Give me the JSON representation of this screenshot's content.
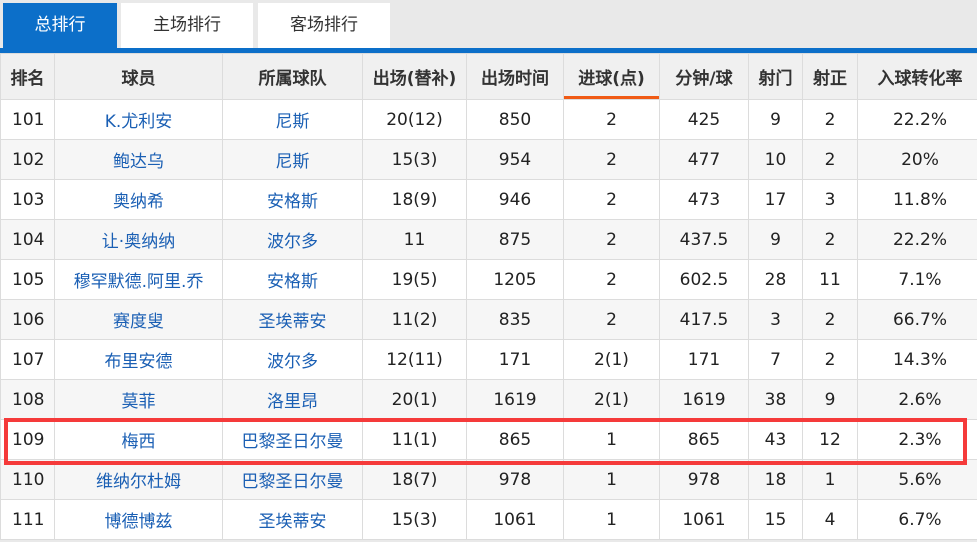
{
  "tabs": [
    {
      "label": "总排行",
      "active": true
    },
    {
      "label": "主场排行",
      "active": false
    },
    {
      "label": "客场排行",
      "active": false
    }
  ],
  "colors": {
    "accent": "#0c6fc9",
    "sort_indicator": "#f05a14",
    "highlight": "#f53a3a",
    "link": "#1a5fb4"
  },
  "table": {
    "headers": [
      "排名",
      "球员",
      "所属球队",
      "出场(替补)",
      "出场时间",
      "进球(点)",
      "分钟/球",
      "射门",
      "射正",
      "入球转化率"
    ],
    "sorted_column": "进球(点)",
    "highlighted_rank": "109",
    "rows": [
      [
        "101",
        "K.尤利安",
        "尼斯",
        "20(12)",
        "850",
        "2",
        "425",
        "9",
        "2",
        "22.2%"
      ],
      [
        "102",
        "鲍达乌",
        "尼斯",
        "15(3)",
        "954",
        "2",
        "477",
        "10",
        "2",
        "20%"
      ],
      [
        "103",
        "奥纳希",
        "安格斯",
        "18(9)",
        "946",
        "2",
        "473",
        "17",
        "3",
        "11.8%"
      ],
      [
        "104",
        "让·奥纳纳",
        "波尔多",
        "11",
        "875",
        "2",
        "437.5",
        "9",
        "2",
        "22.2%"
      ],
      [
        "105",
        "穆罕默德.阿里.乔",
        "安格斯",
        "19(5)",
        "1205",
        "2",
        "602.5",
        "28",
        "11",
        "7.1%"
      ],
      [
        "106",
        "赛度叟",
        "圣埃蒂安",
        "11(2)",
        "835",
        "2",
        "417.5",
        "3",
        "2",
        "66.7%"
      ],
      [
        "107",
        "布里安德",
        "波尔多",
        "12(11)",
        "171",
        "2(1)",
        "171",
        "7",
        "2",
        "14.3%"
      ],
      [
        "108",
        "莫菲",
        "洛里昂",
        "20(1)",
        "1619",
        "2(1)",
        "1619",
        "38",
        "9",
        "2.6%"
      ],
      [
        "109",
        "梅西",
        "巴黎圣日尔曼",
        "11(1)",
        "865",
        "1",
        "865",
        "43",
        "12",
        "2.3%"
      ],
      [
        "110",
        "维纳尔杜姆",
        "巴黎圣日尔曼",
        "18(7)",
        "978",
        "1",
        "978",
        "18",
        "1",
        "5.6%"
      ],
      [
        "111",
        "博德博兹",
        "圣埃蒂安",
        "15(3)",
        "1061",
        "1",
        "1061",
        "15",
        "4",
        "6.7%"
      ]
    ]
  }
}
